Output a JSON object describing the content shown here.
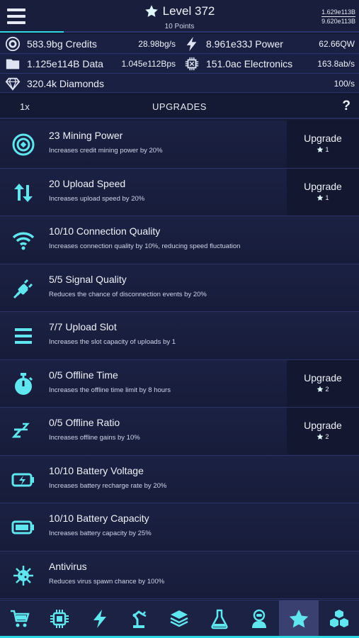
{
  "header": {
    "level_label": "Level 372",
    "points_label": "10 Points",
    "progress_current": "1.629e113B",
    "progress_max": "9.620e113B"
  },
  "resources": [
    {
      "name": "583.9bg Credits",
      "rate": "28.98bg/s",
      "icon": "credit-coin-icon"
    },
    {
      "name": "8.961e33J Power",
      "rate": "62.66QW",
      "icon": "lightning-icon"
    },
    {
      "name": "1.125e114B Data",
      "rate": "1.045e112Bps",
      "icon": "folder-icon"
    },
    {
      "name": "151.0ac Electronics",
      "rate": "163.8ab/s",
      "icon": "chip-icon"
    },
    {
      "name": "320.4k Diamonds",
      "rate": "100/s",
      "icon": "diamond-icon"
    }
  ],
  "toolbar": {
    "multiplier": "1x",
    "title": "UPGRADES",
    "help": "?"
  },
  "upgrades": [
    {
      "title": "23 Mining Power",
      "desc": "Increases credit mining power by 20%",
      "button": "Upgrade",
      "cost": "1",
      "icon": "target-coin-icon"
    },
    {
      "title": "20 Upload Speed",
      "desc": "Increases upload speed by 20%",
      "button": "Upgrade",
      "cost": "1",
      "icon": "up-down-arrows-icon"
    },
    {
      "title": "10/10 Connection Quality",
      "desc": "Increases connection quality by 10%, reducing speed fluctuation",
      "icon": "wifi-icon"
    },
    {
      "title": "5/5 Signal Quality",
      "desc": "Reduces the chance of disconnection events by 20%",
      "icon": "plug-icon"
    },
    {
      "title": "7/7 Upload Slot",
      "desc": "Increases the slot capacity of uploads by 1",
      "icon": "bars-icon"
    },
    {
      "title": "0/5 Offline Time",
      "desc": "Increases the offline time limit by 8 hours",
      "button": "Upgrade",
      "cost": "2",
      "icon": "stopwatch-icon"
    },
    {
      "title": "0/5 Offline Ratio",
      "desc": "Increases offline gains by 10%",
      "button": "Upgrade",
      "cost": "2",
      "icon": "sleep-zzz-icon"
    },
    {
      "title": "10/10 Battery Voltage",
      "desc": "Increases battery recharge rate by 20%",
      "icon": "battery-charging-icon"
    },
    {
      "title": "10/10 Battery Capacity",
      "desc": "Increases battery capacity by 25%",
      "icon": "battery-full-icon"
    },
    {
      "title": "Antivirus",
      "desc": "Reduces virus spawn chance by 100%",
      "icon": "virus-icon"
    }
  ],
  "nav": [
    {
      "icon": "cart-icon"
    },
    {
      "icon": "cpu-icon"
    },
    {
      "icon": "lightning-icon"
    },
    {
      "icon": "robot-arm-icon"
    },
    {
      "icon": "layers-icon"
    },
    {
      "icon": "flask-icon"
    },
    {
      "icon": "astronaut-icon"
    },
    {
      "icon": "star-icon",
      "active": true
    },
    {
      "icon": "cubes-icon"
    }
  ],
  "colors": {
    "accent": "#2fd8e0",
    "background": "#151a33",
    "row": "#1b2143",
    "button": "#131830",
    "active_nav": "#3a4070"
  }
}
